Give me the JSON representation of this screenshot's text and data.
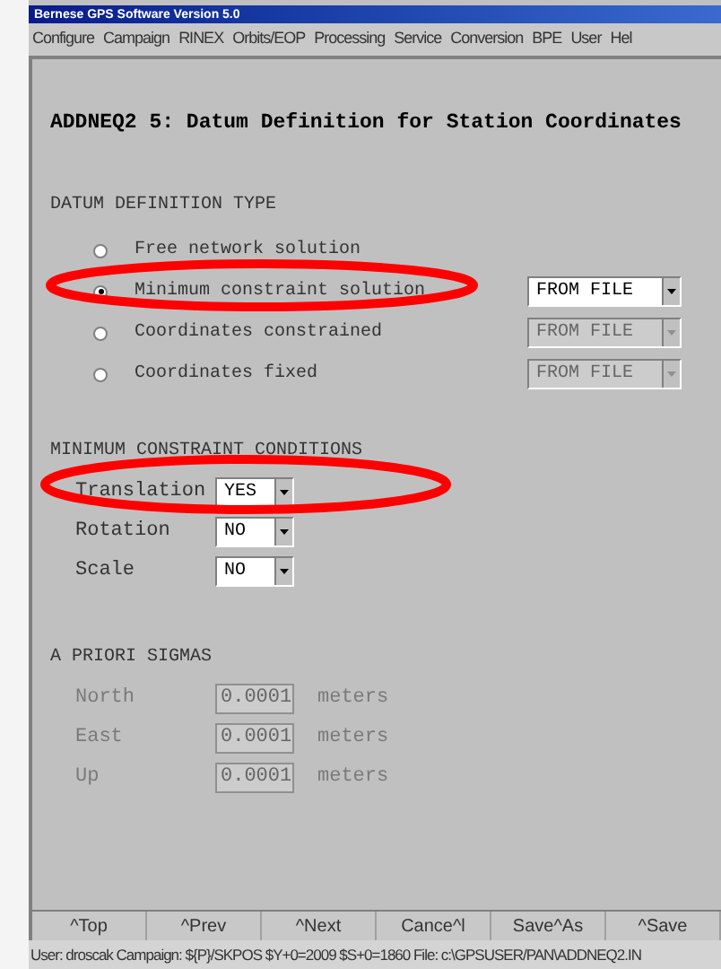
{
  "window": {
    "title": "Bernese GPS Software Version 5.0"
  },
  "menu": [
    "Configure",
    "Campaign",
    "RINEX",
    "Orbits/EOP",
    "Processing",
    "Service",
    "Conversion",
    "BPE",
    "User",
    "Hel"
  ],
  "panel_title": "ADDNEQ2 5: Datum Definition for Station Coordinates",
  "datum_definition": {
    "heading": "DATUM DEFINITION TYPE",
    "options": [
      {
        "label": "Free network solution",
        "selected": false
      },
      {
        "label": "Minimum constraint solution",
        "selected": true,
        "dropdown": {
          "value": "FROM FILE",
          "disabled": false
        }
      },
      {
        "label": "Coordinates constrained",
        "selected": false,
        "dropdown": {
          "value": "FROM FILE",
          "disabled": true
        }
      },
      {
        "label": "Coordinates fixed",
        "selected": false,
        "dropdown": {
          "value": "FROM FILE",
          "disabled": true
        }
      }
    ]
  },
  "constraint_conditions": {
    "heading": "MINIMUM CONSTRAINT CONDITIONS",
    "rows": [
      {
        "label": "Translation",
        "value": "YES"
      },
      {
        "label": "Rotation",
        "value": "NO"
      },
      {
        "label": "Scale",
        "value": "NO"
      }
    ]
  },
  "a_priori_sigmas": {
    "heading": "A PRIORI SIGMAS",
    "rows": [
      {
        "label": "North",
        "value": "0.0001",
        "unit": "meters",
        "disabled": true
      },
      {
        "label": "East",
        "value": "0.0001",
        "unit": "meters",
        "disabled": true
      },
      {
        "label": "Up",
        "value": "0.0001",
        "unit": "meters",
        "disabled": true
      }
    ]
  },
  "buttons": [
    "^Top",
    "^Prev",
    "^Next",
    "Cance^l",
    "Save^As",
    "^Save"
  ],
  "status_bar": "User: droscak Campaign: ${P}/SKPOS  $Y+0=2009  $S+0=1860  File: c:\\GPSUSER/PAN\\ADDNEQ2.IN"
}
